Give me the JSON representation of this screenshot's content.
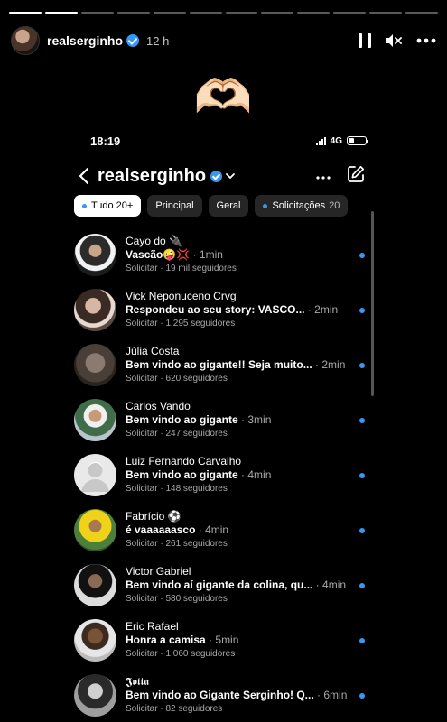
{
  "story": {
    "segments_total": 12,
    "segments_done": 2,
    "username": "realserginho",
    "time_ago": "12 h",
    "emoji": "🫶🏻"
  },
  "phone": {
    "clock": "18:19",
    "network": "4G",
    "battery_level": 0.35,
    "header": {
      "title": "realserginho",
      "more_icon": "more-horizontal-icon",
      "compose_icon": "compose-icon"
    },
    "filters": [
      {
        "label": "Tudo",
        "count": "20+",
        "active": true,
        "dot": true
      },
      {
        "label": "Principal",
        "count": "",
        "active": false,
        "dot": false
      },
      {
        "label": "Geral",
        "count": "",
        "active": false,
        "dot": false
      },
      {
        "label": "Solicitações",
        "count": "20",
        "active": false,
        "dot": true
      }
    ],
    "messages": [
      {
        "name": "Cayo do 🔌",
        "message": "Vascão🤪💢",
        "time": "1min",
        "action": "Solicitar",
        "followers": "19 mil seguidores"
      },
      {
        "name": "Vick Neponuceno Crvg",
        "message": "Respondeu ao seu story: VASCO...",
        "time": "2min",
        "action": "Solicitar",
        "followers": "1.295 seguidores"
      },
      {
        "name": "Júlia Costa",
        "message": "Bem vindo ao gigante!! Seja muito...",
        "time": "2min",
        "action": "Solicitar",
        "followers": "620 seguidores"
      },
      {
        "name": "Carlos Vando",
        "message": "Bem vindo ao gigante",
        "time": "3min",
        "action": "Solicitar",
        "followers": "247 seguidores"
      },
      {
        "name": "Luiz Fernando Carvalho",
        "message": "Bem vindo ao gigante",
        "time": "4min",
        "action": "Solicitar",
        "followers": "148 seguidores"
      },
      {
        "name": "Fabrício ⚽",
        "message": "é vaaaaaasco",
        "time": "4min",
        "action": "Solicitar",
        "followers": "261 seguidores"
      },
      {
        "name": "Victor Gabriel",
        "message": "Bem vindo aí gigante da colina, qu...",
        "time": "4min",
        "action": "Solicitar",
        "followers": "580 seguidores"
      },
      {
        "name": "Eric Rafael",
        "message": "Honra a camisa",
        "time": "5min",
        "action": "Solicitar",
        "followers": "1.060 seguidores"
      },
      {
        "name": "𝕵𝖔𝖙𝖙𝖆",
        "message": "Bem vindo ao Gigante Serginho! Q...",
        "time": "6min",
        "action": "Solicitar",
        "followers": "82 seguidores"
      }
    ]
  },
  "colors": {
    "accent": "#3897f0",
    "background": "#000000",
    "chip": "#262626",
    "muted": "#a8a8a8"
  }
}
